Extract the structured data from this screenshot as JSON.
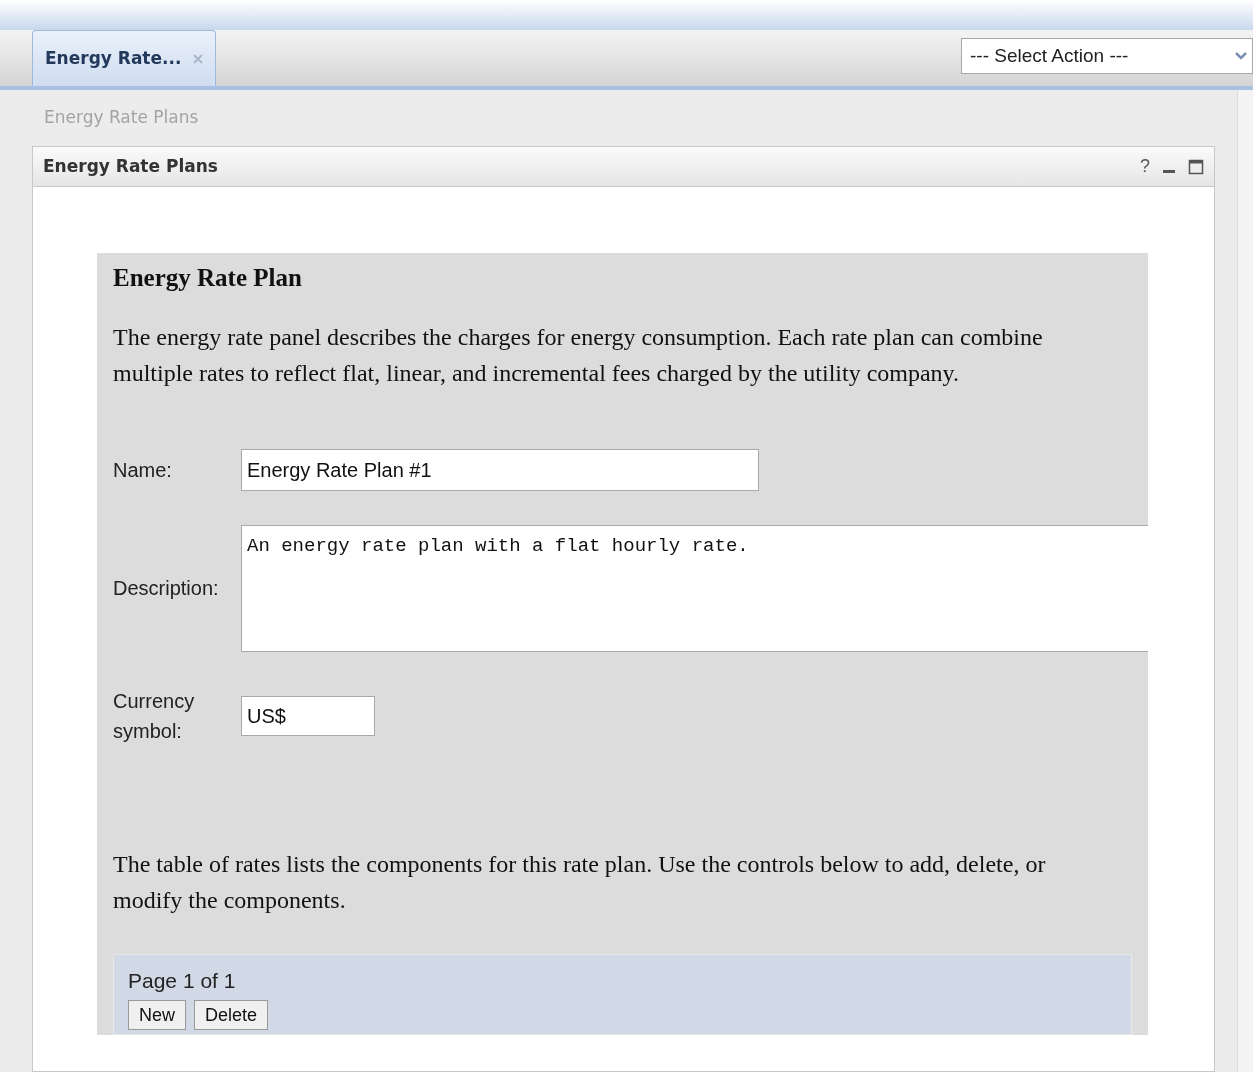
{
  "tabs": [
    {
      "label": "Energy Rate...",
      "selected": true,
      "closable": true
    }
  ],
  "action_select": {
    "value": "--- Select Action ---"
  },
  "breadcrumb": "Energy Rate Plans",
  "portlet": {
    "title": "Energy Rate Plans",
    "controls": [
      "?"
    ]
  },
  "form": {
    "heading": "Energy Rate Plan",
    "intro": "The energy rate panel describes the charges for energy consumption. Each rate plan can combine multiple rates to reflect flat, linear, and incremental fees charged by the utility company.",
    "fields": [
      {
        "kind": "text",
        "label": "Name:",
        "value": "Energy Rate Plan #1"
      },
      {
        "kind": "textarea",
        "label": "Description:",
        "value": "An energy rate plan with a flat hourly rate."
      },
      {
        "kind": "short",
        "label": "Currency symbol:",
        "value": "US$"
      }
    ],
    "table_intro": "The table of rates lists the components for this rate plan. Use the controls below to add, delete, or modify the components.",
    "pager": "Page 1 of 1",
    "buttons": [
      "New",
      "Delete"
    ]
  }
}
